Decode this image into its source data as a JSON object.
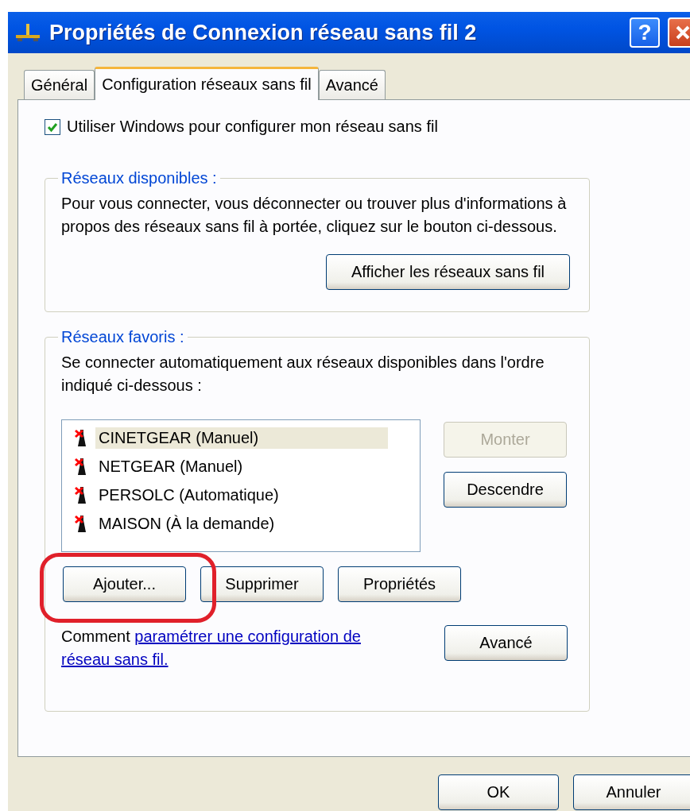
{
  "window": {
    "title": "Propriétés de Connexion réseau sans fil 2",
    "help_button": "?"
  },
  "tabs": [
    {
      "label": "Général",
      "selected": false
    },
    {
      "label": "Configuration réseaux sans fil",
      "selected": true
    },
    {
      "label": "Avancé",
      "selected": false
    }
  ],
  "use_windows_checkbox": {
    "label": "Utiliser Windows pour configurer mon réseau sans fil",
    "checked": true
  },
  "available_networks": {
    "title": "Réseaux disponibles :",
    "text": "Pour vous connecter, vous déconnecter ou trouver plus d'informations à propos des réseaux sans fil à portée, cliquez sur le bouton ci-dessous.",
    "button": "Afficher les réseaux sans fil"
  },
  "preferred_networks": {
    "title": "Réseaux favoris :",
    "text": "Se connecter automatiquement aux réseaux disponibles dans l'ordre indiqué ci-dessous :",
    "items": [
      {
        "label": "CINETGEAR (Manuel)",
        "selected": true
      },
      {
        "label": "NETGEAR (Manuel)",
        "selected": false
      },
      {
        "label": "PERSOLC (Automatique)",
        "selected": false
      },
      {
        "label": "MAISON (À la demande)",
        "selected": false
      }
    ],
    "side_buttons": [
      {
        "label": "Monter",
        "disabled": true
      },
      {
        "label": "Descendre",
        "disabled": false
      }
    ],
    "buttons": [
      {
        "label": "Ajouter...",
        "highlighted": true
      },
      {
        "label": "Supprimer",
        "highlighted": false
      },
      {
        "label": "Propriétés",
        "highlighted": false
      }
    ],
    "help_prefix": "Comment",
    "help_link": [
      "paramétrer une configuration de",
      "réseau sans fil."
    ],
    "advanced_button": "Avancé"
  },
  "dialog_buttons": [
    "OK",
    "Annuler"
  ]
}
